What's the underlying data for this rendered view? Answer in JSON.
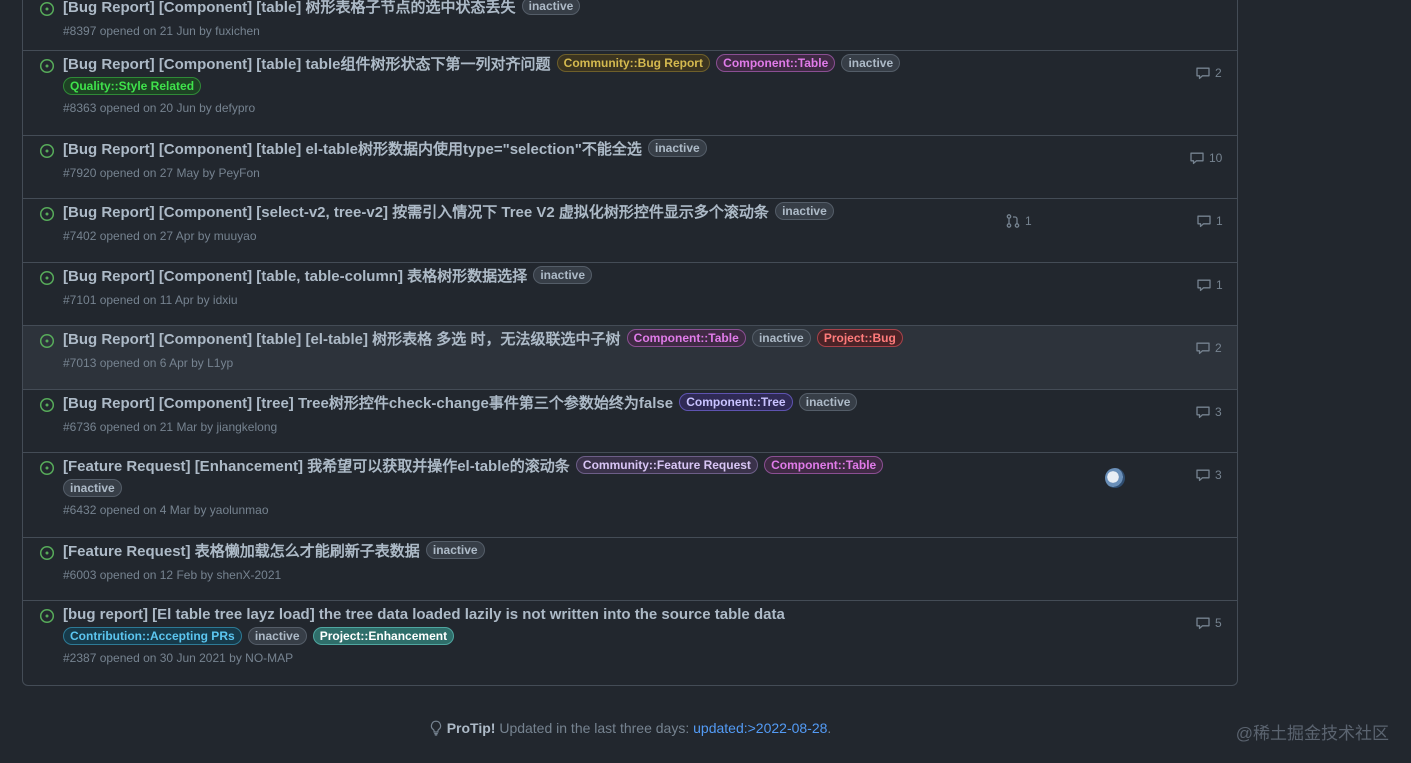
{
  "colors": {
    "open_icon": "#57ab5a",
    "link": "#539bf5"
  },
  "issues": [
    {
      "title": "[Bug Report] [Component] [table] 树形表格子节点的选中状态丢失",
      "labels": [
        {
          "text": "inactive",
          "fg": "#adbac7",
          "bg": "#373e47",
          "border": "#545d68"
        }
      ],
      "meta": {
        "prefix": "#8397 opened on 21 Jun by ",
        "author": "fuxichen"
      }
    },
    {
      "title": "[Bug Report] [Component] [table] table组件树形状态下第一列对齐问题",
      "labels": [
        {
          "text": "Community::Bug Report",
          "fg": "#d4b94f",
          "bg": "#3b3420",
          "border": "#6e5f2a"
        },
        {
          "text": "Component::Table",
          "fg": "#e07be9",
          "bg": "#3f2a44",
          "border": "#8b4f93"
        },
        {
          "text": "inactive",
          "fg": "#adbac7",
          "bg": "#373e47",
          "border": "#545d68"
        },
        {
          "text": "Quality::Style Related",
          "fg": "#3fe24b",
          "bg": "#1e4224",
          "border": "#2f8a37"
        }
      ],
      "meta": {
        "prefix": "#8363 opened on 20 Jun by ",
        "author": "defypro"
      },
      "comments": "2"
    },
    {
      "title": "[Bug Report] [Component] [table] el-table树形数据内使用type=\"selection\"不能全选",
      "labels": [
        {
          "text": "inactive",
          "fg": "#adbac7",
          "bg": "#373e47",
          "border": "#545d68"
        }
      ],
      "meta": {
        "prefix": "#7920 opened on 27 May by ",
        "author": "PeyFon"
      },
      "comments": "10"
    },
    {
      "title": "[Bug Report] [Component] [select-v2, tree-v2] 按需引入情况下 Tree V2 虚拟化树形控件显示多个滚动条",
      "labels": [
        {
          "text": "inactive",
          "fg": "#adbac7",
          "bg": "#373e47",
          "border": "#545d68"
        }
      ],
      "meta": {
        "prefix": "#7402 opened on 27 Apr by ",
        "author": "muuyao"
      },
      "prs": "1",
      "comments": "1"
    },
    {
      "title": "[Bug Report] [Component] [table, table-column] 表格树形数据选择",
      "labels": [
        {
          "text": "inactive",
          "fg": "#adbac7",
          "bg": "#373e47",
          "border": "#545d68"
        }
      ],
      "meta": {
        "prefix": "#7101 opened on 11 Apr by ",
        "author": "idxiu"
      },
      "comments": "1"
    },
    {
      "title": "[Bug Report] [Component] [table] [el-table] 树形表格 多选 时，无法级联选中子树",
      "labels": [
        {
          "text": "Component::Table",
          "fg": "#e07be9",
          "bg": "#3f2a44",
          "border": "#8b4f93"
        },
        {
          "text": "inactive",
          "fg": "#adbac7",
          "bg": "#373e47",
          "border": "#545d68"
        },
        {
          "text": "Project::Bug",
          "fg": "#ff7b7b",
          "bg": "#4a2327",
          "border": "#a8424a"
        }
      ],
      "meta": {
        "prefix": "#7013 opened on 6 Apr by ",
        "author": "L1yp"
      },
      "comments": "2"
    },
    {
      "title": "[Bug Report] [Component] [tree] Tree树形控件check-change事件第三个参数始终为false",
      "labels": [
        {
          "text": "Component::Tree",
          "fg": "#c9c3ff",
          "bg": "#2f2a55",
          "border": "#5e53b0"
        },
        {
          "text": "inactive",
          "fg": "#adbac7",
          "bg": "#373e47",
          "border": "#545d68"
        }
      ],
      "meta": {
        "prefix": "#6736 opened on 21 Mar by ",
        "author": "jiangkelong"
      },
      "comments": "3"
    },
    {
      "title": "[Feature Request] [Enhancement] 我希望可以获取并操作el-table的滚动条",
      "labels": [
        {
          "text": "Community::Feature Request",
          "fg": "#d8c5f5",
          "bg": "#3a324a",
          "border": "#6d5e88"
        },
        {
          "text": "Component::Table",
          "fg": "#e07be9",
          "bg": "#3f2a44",
          "border": "#8b4f93"
        },
        {
          "text": "inactive",
          "fg": "#adbac7",
          "bg": "#373e47",
          "border": "#545d68"
        }
      ],
      "meta": {
        "prefix": "#6432 opened on 4 Mar by ",
        "author": "yaolunmao"
      },
      "comments": "3"
    },
    {
      "title": "[Feature Request] 表格懒加载怎么才能刷新子表数据",
      "labels": [
        {
          "text": "inactive",
          "fg": "#adbac7",
          "bg": "#373e47",
          "border": "#545d68"
        }
      ],
      "meta": {
        "prefix": "#6003 opened on 12 Feb by ",
        "author": "shenX-2021"
      }
    },
    {
      "title": "[bug report] [El table tree layz load] the tree data loaded lazily is not written into the source table data",
      "labels": [
        {
          "text": "Contribution::Accepting PRs",
          "fg": "#5cc6f0",
          "bg": "#173a4a",
          "border": "#2d7a96"
        },
        {
          "text": "inactive",
          "fg": "#adbac7",
          "bg": "#373e47",
          "border": "#545d68"
        },
        {
          "text": "Project::Enhancement",
          "fg": "#ffffff",
          "bg": "#2f6e6a",
          "border": "#4fa6a0"
        }
      ],
      "meta": {
        "prefix": "#2387 opened on 30 Jun 2021 by ",
        "author": "NO-MAP"
      },
      "comments": "5"
    }
  ],
  "protip": {
    "icon": "light-bulb-icon",
    "label": "ProTip!",
    "text": " Updated in the last three days: ",
    "query": "updated:>2022-08-28",
    "suffix": "."
  },
  "watermark": "@稀土掘金技术社区"
}
